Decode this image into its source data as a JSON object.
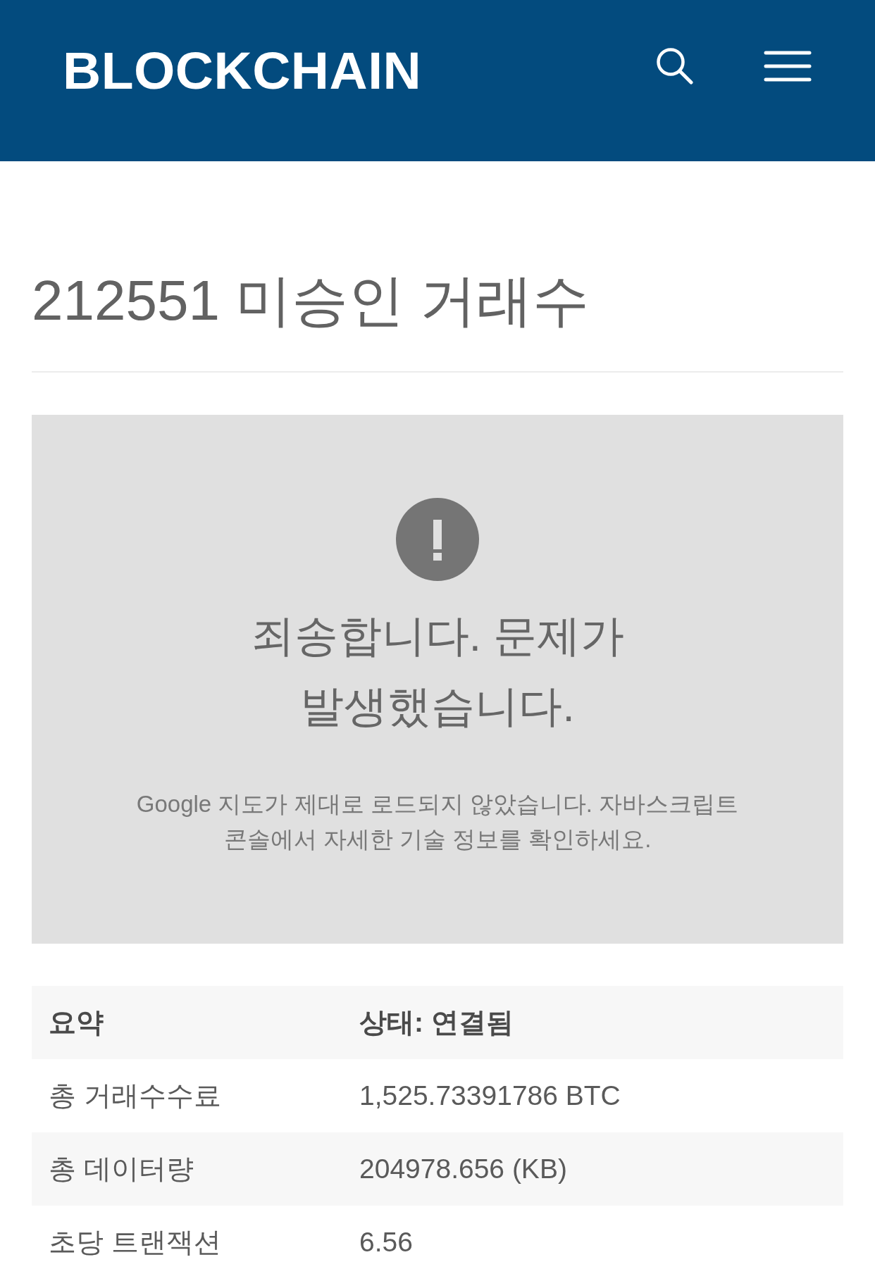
{
  "header": {
    "logo": "BLOCKCHAIN"
  },
  "page_title": "212551 미승인 거래수",
  "map_error": {
    "heading": "죄송합니다. 문제가 발생했습니다.",
    "message": "Google 지도가 제대로 로드되지 않았습니다. 자바스크립트 콘솔에서 자세한 기술 정보를 확인하세요."
  },
  "summary_table": {
    "columns": [
      "요약",
      "상태: 연결됨"
    ],
    "rows": [
      [
        "총 거래수수료",
        "1,525.73391786 BTC"
      ],
      [
        "총 데이터량",
        "204978.656 (KB)"
      ],
      [
        "초당 트랜잭션",
        "6.56"
      ]
    ]
  }
}
